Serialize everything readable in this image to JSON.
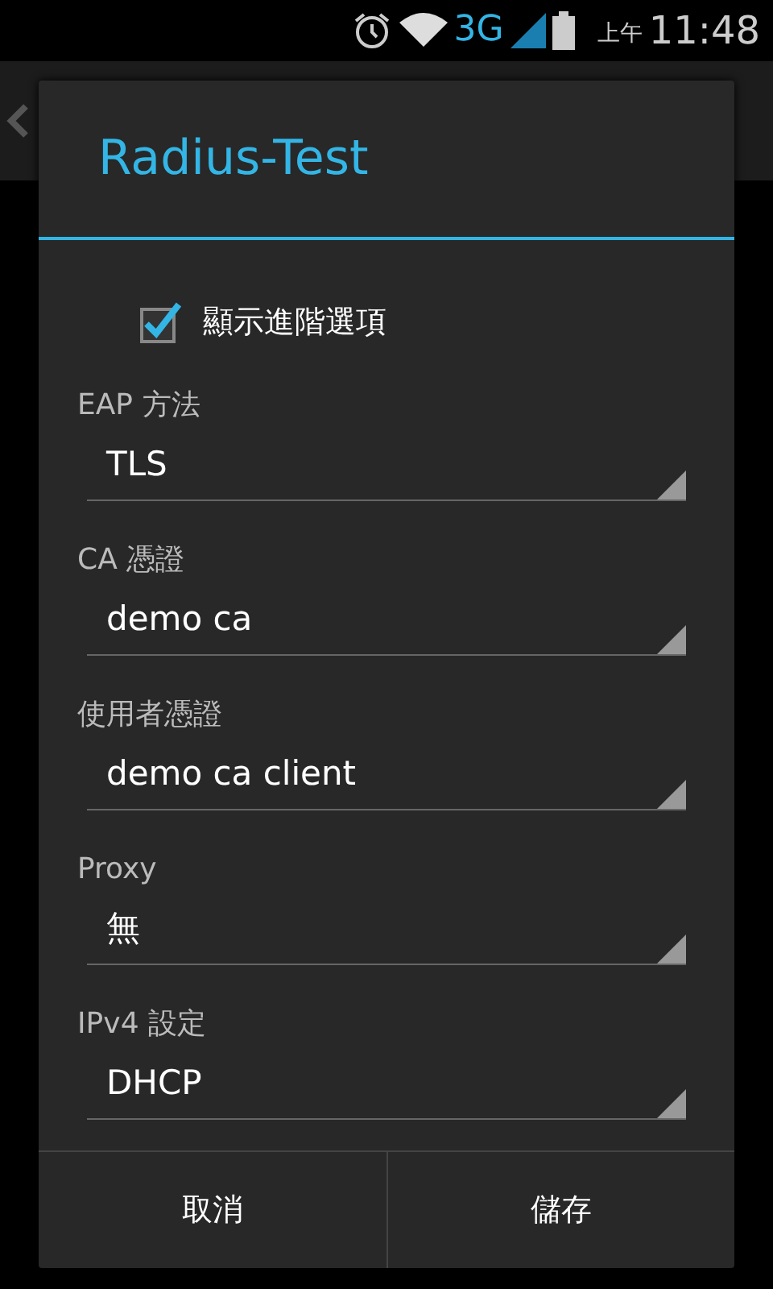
{
  "status_bar": {
    "network": "3G",
    "am_pm": "上午",
    "time": "11:48"
  },
  "dialog": {
    "title": "Radius-Test",
    "advanced_checkbox": {
      "label": "顯示進階選項",
      "checked": true
    },
    "fields": [
      {
        "label": "EAP 方法",
        "value": "TLS"
      },
      {
        "label": "CA 憑證",
        "value": "demo ca"
      },
      {
        "label": "使用者憑證",
        "value": "demo ca client"
      },
      {
        "label": "Proxy",
        "value": "無"
      },
      {
        "label": "IPv4 設定",
        "value": "DHCP"
      }
    ],
    "buttons": [
      "取消",
      "儲存"
    ]
  }
}
